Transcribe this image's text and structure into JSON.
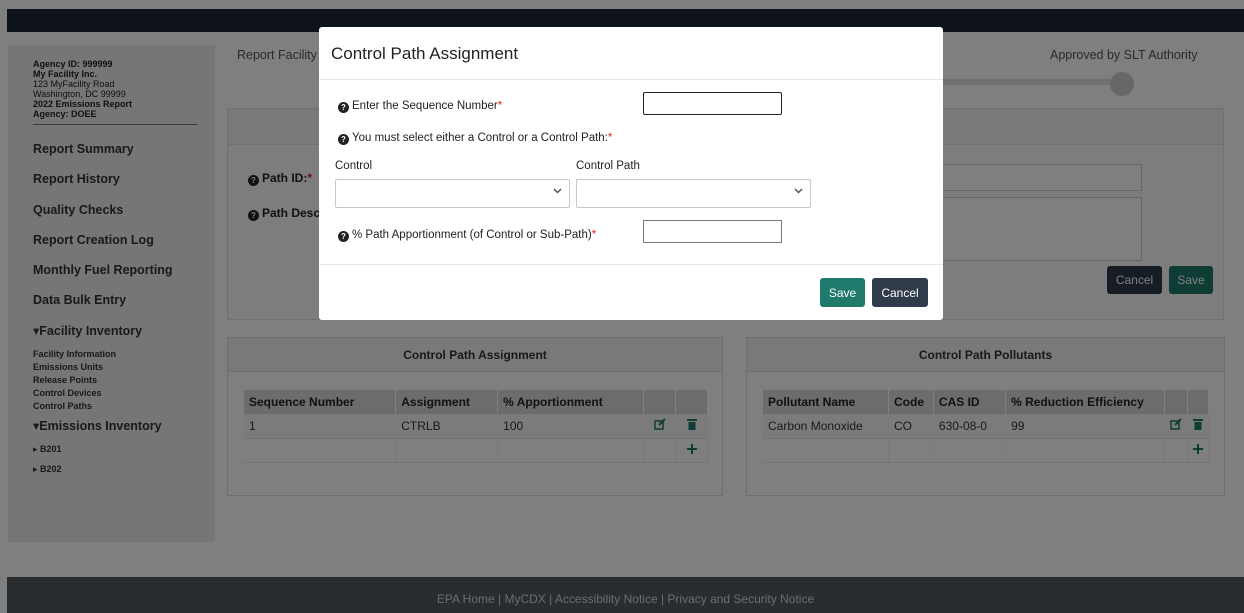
{
  "sidebar": {
    "agency_id": "Agency ID: 999999",
    "facility_name": "My Facility Inc.",
    "address1": "123 MyFacility Road",
    "address2": "Washington, DC 99999",
    "report": "2022 Emissions Report",
    "agency": "Agency: DOEE",
    "nav": [
      "Report Summary",
      "Report History",
      "Quality Checks",
      "Report Creation Log",
      "Monthly Fuel Reporting",
      "Data Bulk Entry"
    ],
    "facility_inventory": "▾Facility Inventory",
    "facility_items": [
      "Facility Information",
      "Emissions Units",
      "Release Points",
      "Control Devices",
      "Control Paths"
    ],
    "emissions_inventory": "▾Emissions Inventory",
    "emissions_items": [
      "▸ B201",
      "▸ B202"
    ]
  },
  "main": {
    "status_left": "Report Facility",
    "status_right": "Approved by SLT Authority",
    "path_id_label": "Path ID:",
    "path_desc_label": "Path Desc",
    "cancel_label": "Cancel",
    "save_label": "Save"
  },
  "assignment_card": {
    "title": "Control Path Assignment",
    "columns": [
      "Sequence Number",
      "Assignment",
      "% Apportionment"
    ],
    "rows": [
      {
        "sequence": "1",
        "assignment": "CTRLB",
        "apportionment": "100"
      }
    ]
  },
  "pollutants_card": {
    "title": "Control Path Pollutants",
    "columns": [
      "Pollutant Name",
      "Code",
      "CAS ID",
      "% Reduction Efficiency"
    ],
    "rows": [
      {
        "name": "Carbon Monoxide",
        "code": "CO",
        "cas": "630-08-0",
        "efficiency": "99"
      }
    ]
  },
  "modal": {
    "title": "Control Path Assignment",
    "sequence_label": "Enter the Sequence Number",
    "sequence_value": "",
    "select_prompt": "You must select either a Control or a Control Path:",
    "control_label": "Control",
    "control_value": "",
    "control_path_label": "Control Path",
    "control_path_value": "",
    "apportionment_label": "% Path Apportionment (of Control or Sub-Path)",
    "apportionment_value": "",
    "save_label": "Save",
    "cancel_label": "Cancel",
    "required_mark": "*",
    "help_glyph": "?"
  },
  "footer": {
    "text": "EPA Home | MyCDX | Accessibility Notice | Privacy and Security Notice"
  },
  "icons": {
    "edit": "edit-icon",
    "delete": "trash-icon",
    "add": "plus-icon",
    "help": "question-circle-icon",
    "dropdown": "chevron-down-icon"
  },
  "colors": {
    "primary_green": "#1f7a6b",
    "dark_button": "#2f3a4a",
    "navbar": "#1d2532",
    "footer": "#555b60",
    "required": "#dd2222"
  }
}
